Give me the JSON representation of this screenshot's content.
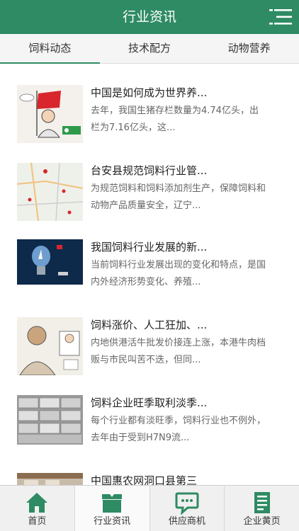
{
  "header": {
    "title": "行业资讯"
  },
  "tabs": [
    {
      "label": "饲料动态",
      "active": true
    },
    {
      "label": "技术配方",
      "active": false
    },
    {
      "label": "动物营养",
      "active": false
    }
  ],
  "articles": [
    {
      "title": "中国是如何成为世界养...",
      "summary": "去年，我国生猪存栏数量为4.74亿头，出栏为7.16亿头，这...",
      "thumb": "cartoon-flag"
    },
    {
      "title": "台安县规范饲料行业管...",
      "summary": "为规范饲料和饲料添加剂生产，保障饲料和动物产品质量安全，辽宁...",
      "thumb": "map"
    },
    {
      "title": "我国饲料行业发展的新...",
      "summary": "当前饲料行业发展出现的变化和特点，是国内外经济形势变化、养殖...",
      "thumb": "lightbulb"
    },
    {
      "title": "饲料涨价、人工狂加、...",
      "summary": "内地供港活牛批发价接连上涨，本港牛肉档贩与市民叫苦不迭，但同...",
      "thumb": "cartoon-market"
    },
    {
      "title": "饲料企业旺季取利淡季...",
      "summary": "每个行业都有淡旺季，饲料行业也不例外，去年由于受到H7N9流...",
      "thumb": "feed-bags"
    },
    {
      "title": "中国惠农网洞口县第三",
      "summary": "",
      "thumb": "building"
    }
  ],
  "bottom_nav": [
    {
      "label": "首页",
      "icon": "home-icon",
      "active": false
    },
    {
      "label": "行业资讯",
      "icon": "box-icon",
      "active": true
    },
    {
      "label": "供应商机",
      "icon": "chat-icon",
      "active": false
    },
    {
      "label": "企业黄页",
      "icon": "document-icon",
      "active": false
    }
  ],
  "colors": {
    "primary": "#2e8b63",
    "header_text": "#ffffff"
  }
}
